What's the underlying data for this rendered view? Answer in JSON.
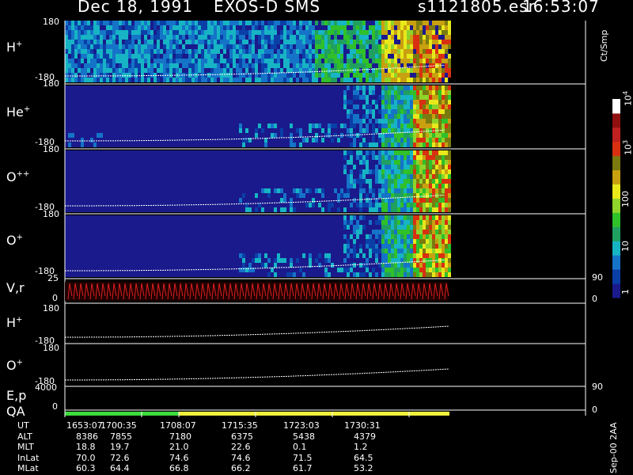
{
  "header": {
    "date": "Dec 18, 1991",
    "mission": "EXOS-D SMS",
    "file": "s1121805.esr",
    "time": "16:53:07"
  },
  "colorbar": {
    "unit": "Ct/Smp",
    "ticks": [
      {
        "label": "1",
        "value": 1
      },
      {
        "label": "10",
        "value": 10
      },
      {
        "label": "100",
        "value": 100
      },
      {
        "label": "10^3",
        "value": 1000
      },
      {
        "label": "10^4",
        "value": 10000
      }
    ],
    "colors": [
      "#1a1a8c",
      "#0a3fa8",
      "#1573c8",
      "#16b4c4",
      "#1fa060",
      "#2fc02a",
      "#8fd42a",
      "#e8e81a",
      "#c8a010",
      "#7a7a10",
      "#d83010",
      "#c02020",
      "#901010",
      "#ffffff"
    ]
  },
  "panels": [
    {
      "ion": "H",
      "sup": "+",
      "ymax": "180",
      "ymin": "-180"
    },
    {
      "ion": "He",
      "sup": "+",
      "ymax": "180",
      "ymin": "-180"
    },
    {
      "ion": "O",
      "sup": "++",
      "ymax": "180",
      "ymin": "-180"
    },
    {
      "ion": "O",
      "sup": "+",
      "ymax": "180",
      "ymin": "-180"
    },
    {
      "ion": "V,r",
      "sup": "",
      "ymax": "25",
      "ymin": "0",
      "rmax": "90",
      "rmin": "0"
    },
    {
      "ion": "H",
      "sup": "+",
      "ymax": "180",
      "ymin": "-180"
    },
    {
      "ion": "O",
      "sup": "+",
      "ymax": "180",
      "ymin": "-180"
    },
    {
      "ion": "E,p",
      "sup": "",
      "ymax": "4000",
      "ymin": "0",
      "rmax": "90",
      "rmin": "0"
    }
  ],
  "qa": {
    "label": "QA",
    "segments": [
      {
        "from": "1653:07",
        "to": "1708:07",
        "color": "#3cdc3c"
      },
      {
        "from": "1708:07",
        "to": "end",
        "color": "#f0f03c"
      }
    ]
  },
  "ephemeris": {
    "rows": [
      {
        "name": "UT",
        "values": [
          "1653:07",
          "1700:35",
          "1708:07",
          "1715:35",
          "1723:03",
          "1730:31"
        ]
      },
      {
        "name": "ALT",
        "values": [
          "8386",
          "7855",
          "7180",
          "6375",
          "5438",
          "4379"
        ]
      },
      {
        "name": "MLT",
        "values": [
          "18.8",
          "19.7",
          "21.0",
          "22.6",
          "0.1",
          "1.2"
        ]
      },
      {
        "name": "InLat",
        "values": [
          "70.0",
          "72.6",
          "74.6",
          "74.6",
          "71.5",
          "64.5"
        ]
      },
      {
        "name": "MLat",
        "values": [
          "60.3",
          "64.4",
          "66.8",
          "66.2",
          "61.7",
          "53.2"
        ]
      }
    ]
  },
  "footer": "Sep-00 2AA",
  "chart_data": {
    "type": "heatmap",
    "title": "Dec 18, 1991 EXOS-D SMS",
    "x_ticks": [
      "1653:07",
      "1700:35",
      "1708:07",
      "1715:35",
      "1723:03",
      "1730:31"
    ],
    "panels": [
      "H+",
      "He+",
      "O++",
      "O+",
      "V,r",
      "H+",
      "O+",
      "E,p"
    ],
    "colorbar_unit": "Ct/Smp",
    "colorbar_range": [
      1,
      10000
    ],
    "colorbar_scale": "log"
  }
}
